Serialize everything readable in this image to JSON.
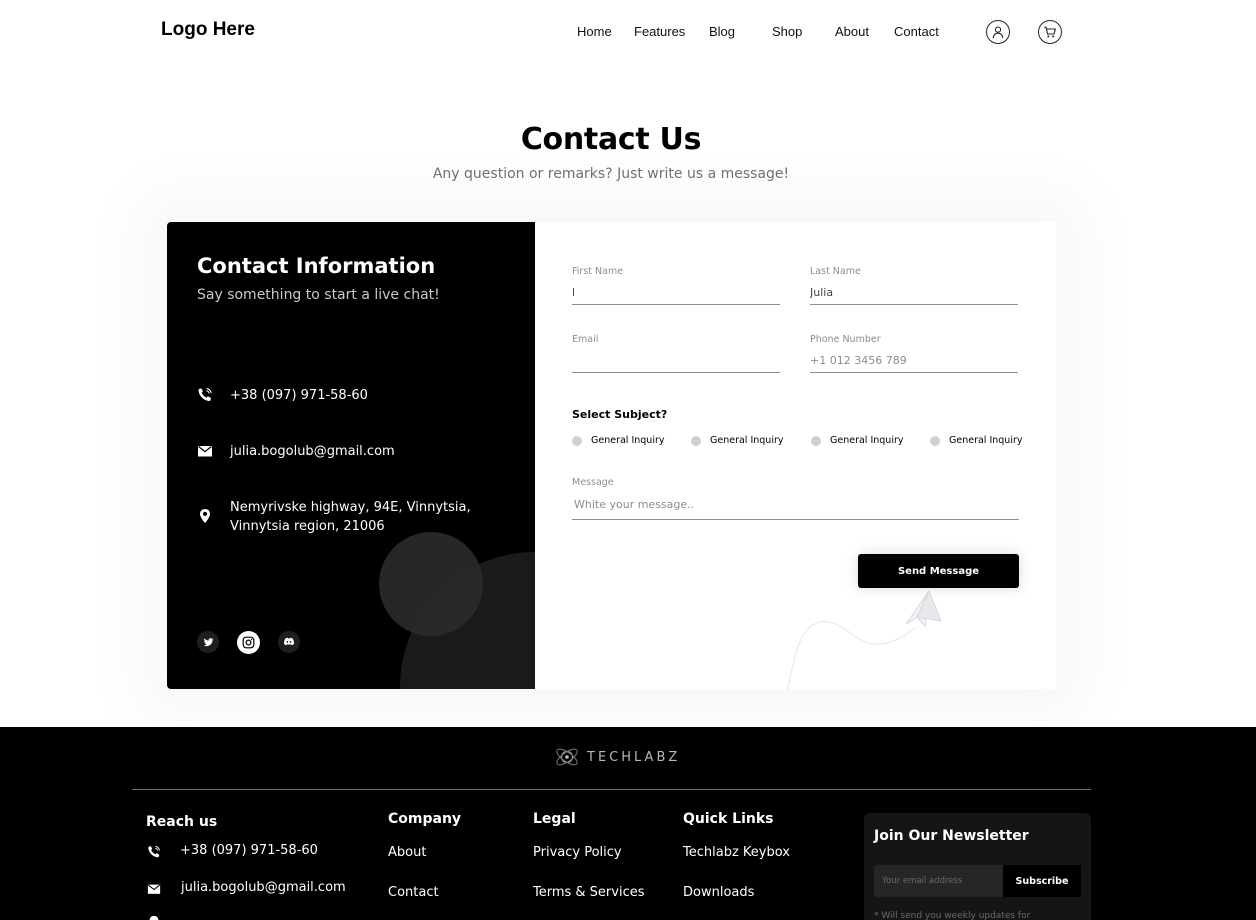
{
  "header": {
    "logo": "Logo Here",
    "nav": [
      "Home",
      "Features",
      "Blog",
      "Shop",
      "About",
      "Contact"
    ],
    "icons": [
      "user-icon",
      "cart-icon"
    ]
  },
  "hero": {
    "title": "Contact Us",
    "subtitle": "Any question or remarks? Just write us a message!"
  },
  "contact_info": {
    "title": "Contact Information",
    "subtitle": "Say something to start a live chat!",
    "phone": "+38 (097) 971-58-60",
    "email": "julia.bogolub@gmail.com",
    "address_line1": "Nemyrivske highway, 94E, Vinnytsia,",
    "address_line2": "Vinnytsia region, 21006",
    "social": [
      "twitter-icon",
      "instagram-icon",
      "discord-icon"
    ],
    "active_social": "instagram-icon"
  },
  "form": {
    "first_name_label": "First Name",
    "first_name_value": "l",
    "last_name_label": "Last Name",
    "last_name_value": "Julia",
    "email_label": "Email",
    "email_value": "",
    "phone_label": "Phone Number",
    "phone_placeholder": "+1 012 3456 789",
    "subject_label": "Select Subject?",
    "subject_options": [
      "General Inquiry",
      "General Inquiry",
      "General Inquiry",
      "General Inquiry"
    ],
    "message_label": "Message",
    "message_placeholder": "White your message..",
    "send_label": "Send Message"
  },
  "footer": {
    "brand": "TECHLABZ",
    "reach_us": {
      "title": "Reach us",
      "phone": "+38 (097) 971-58-60",
      "email": "julia.bogolub@gmail.com"
    },
    "company": {
      "title": "Company",
      "links": [
        "About",
        "Contact"
      ]
    },
    "legal": {
      "title": "Legal",
      "links": [
        "Privacy Policy",
        "Terms & Services"
      ]
    },
    "quick_links": {
      "title": "Quick Links",
      "links": [
        "Techlabz Keybox",
        "Downloads"
      ]
    },
    "newsletter": {
      "title": "Join Our Newsletter",
      "placeholder": "Your email address",
      "button": "Subscribe",
      "note": "* Will send you weekly updates for"
    }
  },
  "colors": {
    "primary": "#000000",
    "background": "#ffffff",
    "muted_text": "#717171",
    "radio_unselected": "#cfcfcf"
  }
}
